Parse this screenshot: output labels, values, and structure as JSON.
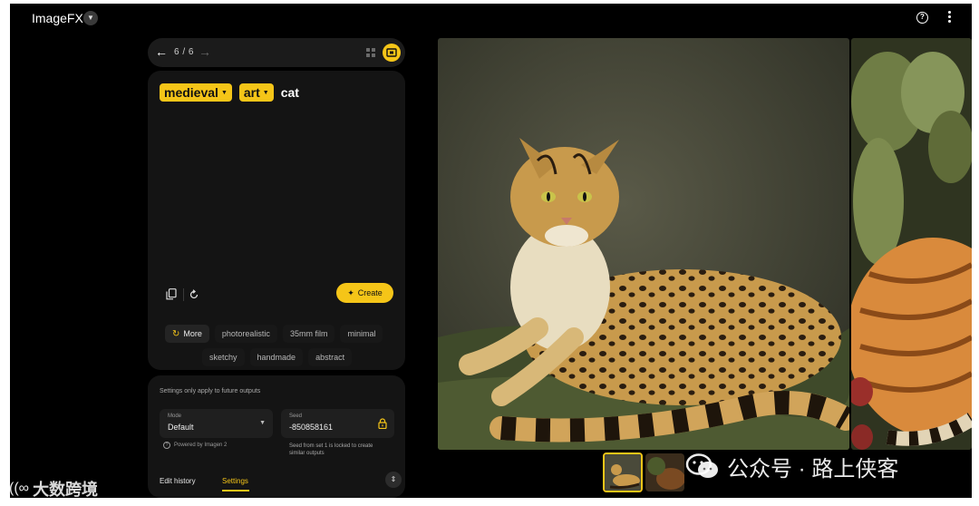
{
  "app": {
    "title": "ImageFX"
  },
  "nav": {
    "counter": "6 / 6"
  },
  "prompt": {
    "chips": [
      "medieval",
      "art"
    ],
    "plain_word": "cat"
  },
  "actions": {
    "create_label": "Create"
  },
  "styles": {
    "more_label": "More",
    "row1": [
      "photorealistic",
      "35mm film",
      "minimal"
    ],
    "row2": [
      "sketchy",
      "handmade",
      "abstract"
    ]
  },
  "settings": {
    "note": "Settings only apply to future outputs",
    "mode_label": "Mode",
    "mode_value": "Default",
    "powered_by": "Powered by Imagen 2",
    "seed_label": "Seed",
    "seed_value": "-850858161",
    "seed_note": "Seed from set 1 is locked to create similar outputs"
  },
  "tabs": {
    "edit_history": "Edit history",
    "settings": "Settings"
  },
  "watermarks": {
    "left": "大数跨境",
    "right": "公众号 · 路上侠客"
  },
  "colors": {
    "accent": "#f5c518",
    "background": "#000000",
    "panel": "#141414"
  }
}
